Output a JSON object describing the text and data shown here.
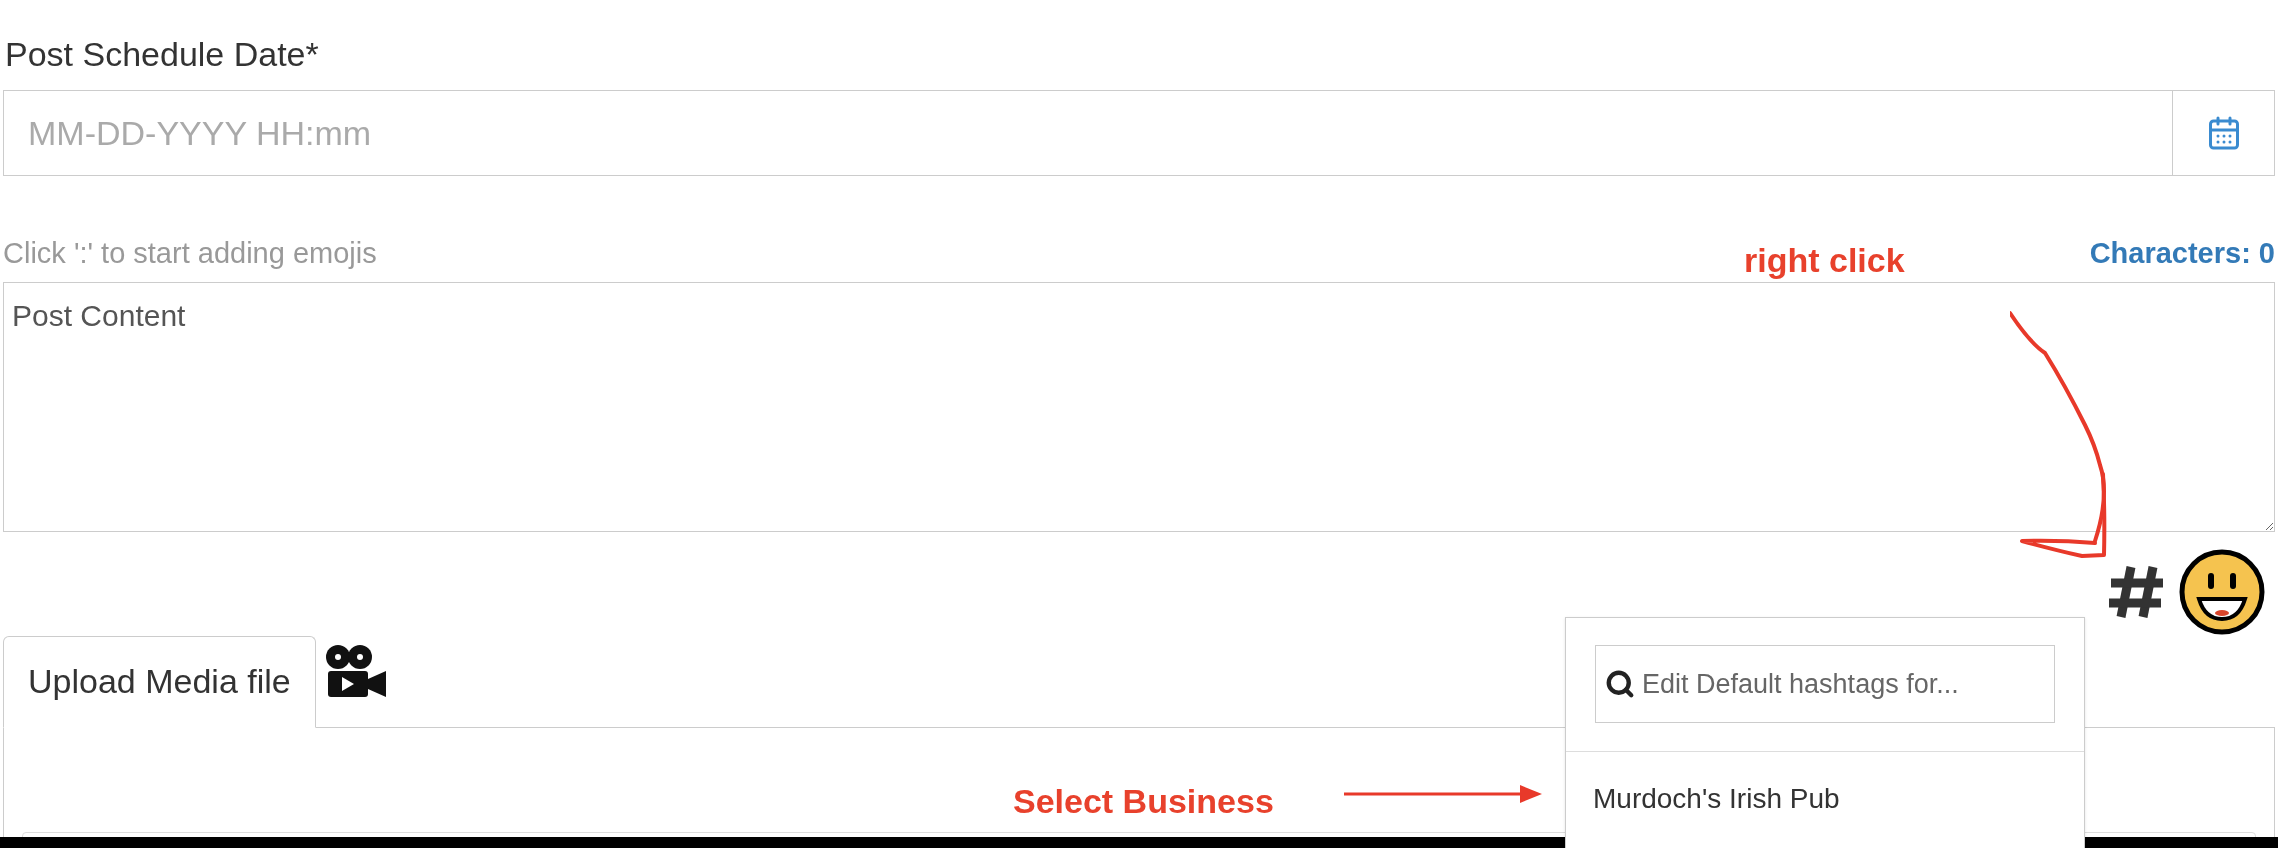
{
  "schedule": {
    "label": "Post Schedule Date*",
    "placeholder": "MM-DD-YYYY HH:mm"
  },
  "content": {
    "hint": "Click ':' to start adding emojis",
    "counter": "Characters: 0",
    "placeholder": "Post Content"
  },
  "media_tabs": [
    {
      "label": "Upload Media file",
      "selected": true
    }
  ],
  "hashtag_menu": {
    "search_placeholder": "Edit Default hashtags for...",
    "items": [
      "Murdoch's Irish Pub"
    ]
  },
  "annotations": [
    {
      "text": "right click"
    },
    {
      "text": "Select Business"
    }
  ]
}
